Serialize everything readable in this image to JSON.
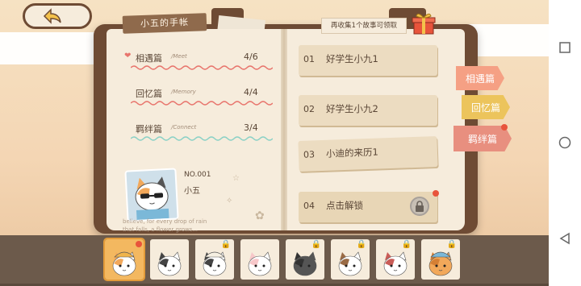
{
  "notebook": {
    "title": "小五的手帐"
  },
  "chapters": [
    {
      "name": "相遇篇",
      "sub": "/Meet",
      "progress": "4/6"
    },
    {
      "name": "回忆篇",
      "sub": "/Memory",
      "progress": "4/4"
    },
    {
      "name": "羁绊篇",
      "sub": "/Connect",
      "progress": "3/4"
    }
  ],
  "profile": {
    "number": "NO.001",
    "name": "小五",
    "quote_line1": "believe, for every drop of rain",
    "quote_line2": "that falls, a flower grows..."
  },
  "reward": {
    "hint": "再收集1个故事可领取",
    "icon": "gift-icon"
  },
  "stories": [
    {
      "num": "01",
      "title": "好学生小九1",
      "locked": false
    },
    {
      "num": "02",
      "title": "好学生小九2",
      "locked": false
    },
    {
      "num": "03",
      "title": "小迪的来历1",
      "locked": false
    },
    {
      "num": "04",
      "title": "点击解锁",
      "locked": true
    }
  ],
  "side_tabs": [
    {
      "label": "相遇篇",
      "color": "#f5a084"
    },
    {
      "label": "回忆篇",
      "color": "#ecc45c"
    },
    {
      "label": "羁绊篇",
      "color": "#e88f7f"
    }
  ],
  "cats": [
    {
      "name": "cat-1",
      "locked": false,
      "active": true
    },
    {
      "name": "cat-2",
      "locked": false,
      "active": false
    },
    {
      "name": "cat-3",
      "locked": true,
      "active": false
    },
    {
      "name": "cat-4",
      "locked": false,
      "active": false
    },
    {
      "name": "cat-5",
      "locked": true,
      "active": false
    },
    {
      "name": "cat-6",
      "locked": true,
      "active": false
    },
    {
      "name": "cat-7",
      "locked": true,
      "active": false
    },
    {
      "name": "cat-8",
      "locked": true,
      "active": false
    }
  ]
}
